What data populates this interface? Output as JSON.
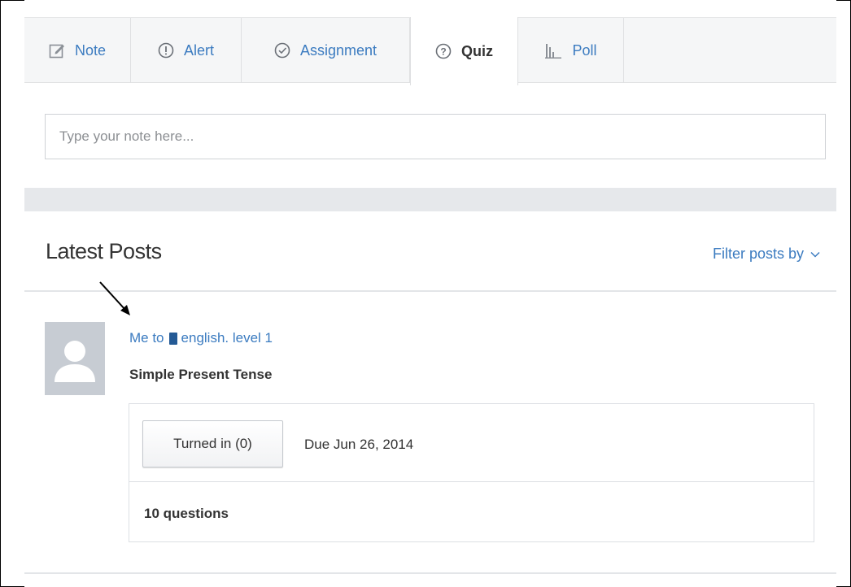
{
  "tabs": [
    {
      "label": "Note",
      "icon": "note-icon",
      "active": false
    },
    {
      "label": "Alert",
      "icon": "alert-icon",
      "active": false
    },
    {
      "label": "Assignment",
      "icon": "assignment-icon",
      "active": false
    },
    {
      "label": "Quiz",
      "icon": "quiz-icon",
      "active": true
    },
    {
      "label": "Poll",
      "icon": "poll-icon",
      "active": false
    }
  ],
  "composer": {
    "placeholder": "Type your note here..."
  },
  "feed": {
    "title": "Latest Posts",
    "filter_label": "Filter posts by"
  },
  "post": {
    "sender": "Me to",
    "group": "english. level 1",
    "title": "Simple Present Tense",
    "turned_in_label": "Turned in (0)",
    "due": "Due Jun 26, 2014",
    "questions": "10 questions"
  },
  "colors": {
    "link": "#3b7bc0",
    "group_icon": "#245a95",
    "avatar_bg": "#c7ccd3"
  }
}
